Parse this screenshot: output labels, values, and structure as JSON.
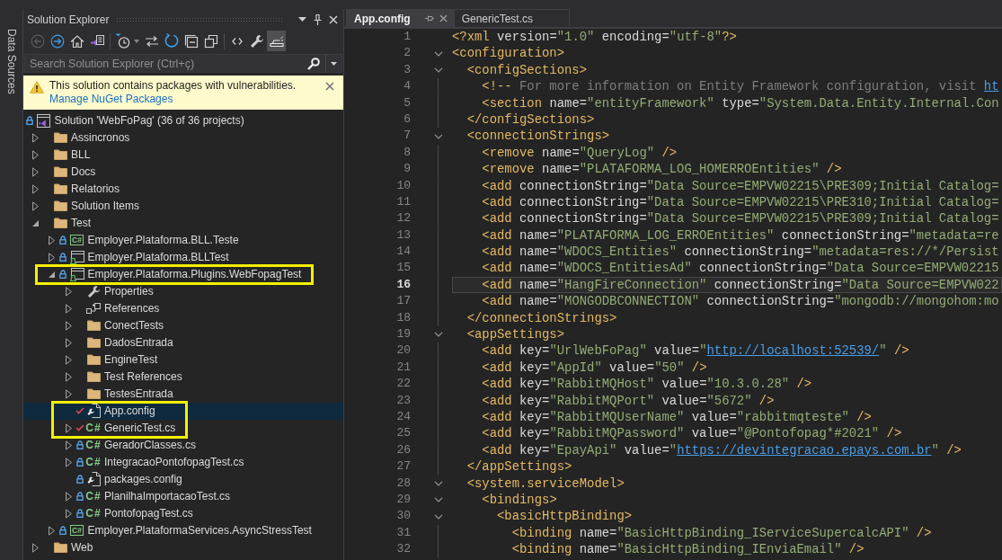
{
  "side_tab": {
    "label": "Data Sources"
  },
  "solution_explorer": {
    "title": "Solution Explorer",
    "toolbar_groups": [
      [
        {
          "kind": "back",
          "disabled": true,
          "on": false
        },
        {
          "kind": "forward",
          "disabled": false,
          "on": false
        },
        {
          "kind": "home",
          "disabled": false,
          "on": false
        },
        {
          "kind": "switch_views",
          "disabled": false,
          "on": false
        }
      ],
      [
        {
          "kind": "pending_changes",
          "disabled": false,
          "on": false
        },
        {
          "kind": "sync",
          "disabled": false,
          "on": false
        },
        {
          "kind": "refresh",
          "disabled": false,
          "on": false
        },
        {
          "kind": "collapse_all",
          "disabled": false,
          "on": false
        },
        {
          "kind": "show_all_files",
          "disabled": false,
          "on": false
        }
      ],
      [
        {
          "kind": "view_code",
          "disabled": false,
          "on": false
        },
        {
          "kind": "properties",
          "disabled": false,
          "on": false
        },
        {
          "kind": "preview",
          "disabled": false,
          "on": true
        }
      ]
    ],
    "search": {
      "placeholder": "Search Solution Explorer (Ctrl+ç)"
    },
    "banner": {
      "message": "This solution contains packages with vulnerabilities.",
      "link": "Manage NuGet Packages"
    },
    "tree": [
      {
        "label": "Solution 'WebFoPag' (36 of 36 projects)",
        "kind": "solution",
        "locked": true,
        "checked_out": false,
        "selected": false,
        "highlighted": false,
        "children": [
          {
            "label": "Assincronos",
            "kind": "folder",
            "locked": false,
            "checked_out": false,
            "expanded": false,
            "selected": false,
            "highlighted": false
          },
          {
            "label": "BLL",
            "kind": "folder",
            "locked": false,
            "checked_out": false,
            "expanded": false,
            "selected": false,
            "highlighted": false
          },
          {
            "label": "Docs",
            "kind": "folder",
            "locked": false,
            "checked_out": false,
            "expanded": false,
            "selected": false,
            "highlighted": false
          },
          {
            "label": "Relatorios",
            "kind": "folder",
            "locked": false,
            "checked_out": false,
            "expanded": false,
            "selected": false,
            "highlighted": false
          },
          {
            "label": "Solution Items",
            "kind": "folder",
            "locked": false,
            "checked_out": false,
            "expanded": false,
            "selected": false,
            "highlighted": false
          },
          {
            "label": "Test",
            "kind": "folder",
            "locked": false,
            "checked_out": false,
            "expanded": true,
            "selected": false,
            "highlighted": false,
            "children": [
              {
                "label": "Employer.Plataforma.BLL.Teste",
                "kind": "csproj",
                "type_label": "C#",
                "locked": true,
                "checked_out": false,
                "expanded": false,
                "selected": false,
                "highlighted": false
              },
              {
                "label": "Employer.Plataforma.BLLTest",
                "kind": "testproj",
                "locked": true,
                "checked_out": false,
                "expanded": false,
                "selected": false,
                "highlighted": false
              },
              {
                "label": "Employer.Plataforma.Plugins.WebFopagTest",
                "kind": "testproj",
                "locked": true,
                "checked_out": false,
                "expanded": true,
                "selected": false,
                "highlighted": true,
                "children": [
                  {
                    "label": "Properties",
                    "kind": "properties",
                    "locked": false,
                    "checked_out": false,
                    "expanded": false,
                    "selected": false,
                    "highlighted": false
                  },
                  {
                    "label": "References",
                    "kind": "references",
                    "locked": false,
                    "checked_out": false,
                    "expanded": false,
                    "selected": false,
                    "highlighted": false
                  },
                  {
                    "label": "ConectTests",
                    "kind": "folder",
                    "locked": false,
                    "checked_out": false,
                    "expanded": false,
                    "selected": false,
                    "highlighted": false
                  },
                  {
                    "label": "DadosEntrada",
                    "kind": "folder",
                    "locked": false,
                    "checked_out": false,
                    "expanded": false,
                    "selected": false,
                    "highlighted": false
                  },
                  {
                    "label": "EngineTest",
                    "kind": "folder",
                    "locked": false,
                    "checked_out": false,
                    "expanded": false,
                    "selected": false,
                    "highlighted": false
                  },
                  {
                    "label": "Test References",
                    "kind": "folder",
                    "locked": false,
                    "checked_out": false,
                    "expanded": false,
                    "selected": false,
                    "highlighted": false
                  },
                  {
                    "label": "TestesEntrada",
                    "kind": "folder",
                    "locked": false,
                    "checked_out": false,
                    "expanded": false,
                    "selected": false,
                    "highlighted": false
                  },
                  {
                    "label": "App.config",
                    "kind": "config",
                    "locked": false,
                    "checked_out": true,
                    "selected": true,
                    "highlighted": true
                  },
                  {
                    "label": "GenericTest.cs",
                    "kind": "cs",
                    "type_label": "C#",
                    "locked": false,
                    "checked_out": true,
                    "expanded": false,
                    "selected": false,
                    "highlighted": true
                  },
                  {
                    "label": "GeradorClasses.cs",
                    "kind": "cs",
                    "type_label": "C#",
                    "locked": true,
                    "checked_out": false,
                    "expanded": false,
                    "selected": false,
                    "highlighted": false
                  },
                  {
                    "label": "IntegracaoPontofopagTest.cs",
                    "kind": "cs",
                    "type_label": "C#",
                    "locked": true,
                    "checked_out": false,
                    "expanded": false,
                    "selected": false,
                    "highlighted": false
                  },
                  {
                    "label": "packages.config",
                    "kind": "config",
                    "locked": true,
                    "checked_out": false,
                    "selected": false,
                    "highlighted": false
                  },
                  {
                    "label": "PlanilhaImportacaoTest.cs",
                    "kind": "cs",
                    "type_label": "C#",
                    "locked": true,
                    "checked_out": false,
                    "expanded": false,
                    "selected": false,
                    "highlighted": false
                  },
                  {
                    "label": "PontofopagTest.cs",
                    "kind": "cs",
                    "type_label": "C#",
                    "locked": true,
                    "checked_out": false,
                    "expanded": false,
                    "selected": false,
                    "highlighted": false
                  }
                ]
              },
              {
                "label": "Employer.PlataformaServices.AsyncStressTest",
                "kind": "csproj",
                "type_label": "C#",
                "locked": true,
                "checked_out": false,
                "expanded": false,
                "selected": false,
                "highlighted": false
              }
            ]
          },
          {
            "label": "Web",
            "kind": "folder",
            "locked": false,
            "checked_out": false,
            "expanded": false,
            "selected": false,
            "highlighted": false
          }
        ]
      }
    ]
  },
  "editor": {
    "tabs": [
      {
        "label": "App.config",
        "selected": true
      },
      {
        "label": "GenericTest.cs",
        "selected": false
      }
    ],
    "lines": [
      {
        "number": "1",
        "text": "<?xml version=\"1.0\" encoding=\"utf-8\"?>",
        "fold": false,
        "current": false
      },
      {
        "number": "2",
        "text": "<configuration>",
        "fold": true,
        "current": false
      },
      {
        "number": "3",
        "text": "  <configSections>",
        "fold": true,
        "current": false
      },
      {
        "number": "4",
        "text": "    <!-- For more information on Entity Framework configuration, visit ",
        "link": "ht",
        "fold": false,
        "current": false
      },
      {
        "number": "5",
        "text": "    <section name=\"entityFramework\" type=\"System.Data.Entity.Internal.Con",
        "fold": false,
        "current": false
      },
      {
        "number": "6",
        "text": "  </configSections>",
        "fold": false,
        "current": false
      },
      {
        "number": "7",
        "text": "  <connectionStrings>",
        "fold": true,
        "current": false
      },
      {
        "number": "8",
        "text": "    <remove name=\"QueryLog\" />",
        "fold": false,
        "current": false
      },
      {
        "number": "9",
        "text": "    <remove name=\"PLATAFORMA_LOG_HOMERROEntities\" />",
        "fold": false,
        "current": false
      },
      {
        "number": "10",
        "text": "    <add connectionString=\"Data Source=EMPVW02215\\PRE309;Initial Catalog=",
        "fold": false,
        "current": false
      },
      {
        "number": "11",
        "text": "    <add connectionString=\"Data Source=EMPVW02215\\PRE310;Initial Catalog=",
        "fold": false,
        "current": false
      },
      {
        "number": "12",
        "text": "    <add connectionString=\"Data Source=EMPVW02215\\PRE309;Initial Catalog=",
        "fold": false,
        "current": false
      },
      {
        "number": "13",
        "text": "    <add name=\"PLATAFORMA_LOG_ERROEntities\" connectionString=\"metadata=re",
        "fold": false,
        "current": false
      },
      {
        "number": "14",
        "text": "    <add name=\"WDOCS_Entities\" connectionString=\"metadata=res://*/Persist",
        "fold": false,
        "current": false
      },
      {
        "number": "15",
        "text": "    <add name=\"WDOCS_EntitiesAd\" connectionString=\"Data Source=EMPVW02215",
        "fold": false,
        "current": false
      },
      {
        "number": "16",
        "text": "    <add name=\"HangFireConnection\" connectionString=\"Data Source=EMPVW022",
        "fold": false,
        "current": true
      },
      {
        "number": "17",
        "text": "    <add name=\"MONGODBCONNECTION\" connectionString=\"mongodb://mongohom:mo",
        "fold": false,
        "current": false
      },
      {
        "number": "18",
        "text": "  </connectionStrings>",
        "fold": false,
        "current": false
      },
      {
        "number": "19",
        "text": "  <appSettings>",
        "fold": true,
        "current": false
      },
      {
        "number": "20",
        "text": "    <add key=\"UrlWebFoPag\" value=\"",
        "link": "http://localhost:52539/",
        "text_after": "\" />",
        "fold": false,
        "current": false
      },
      {
        "number": "21",
        "text": "    <add key=\"AppId\" value=\"50\" />",
        "fold": false,
        "current": false
      },
      {
        "number": "22",
        "text": "    <add key=\"RabbitMQHost\" value=\"10.3.0.28\" />",
        "fold": false,
        "current": false
      },
      {
        "number": "23",
        "text": "    <add key=\"RabbitMQPort\" value=\"5672\" />",
        "fold": false,
        "current": false
      },
      {
        "number": "24",
        "text": "    <add key=\"RabbitMQUserName\" value=\"rabbitmqteste\" />",
        "fold": false,
        "current": false
      },
      {
        "number": "25",
        "text": "    <add key=\"RabbitMQPassword\" value=\"@Pontofopag*#2021\" />",
        "fold": false,
        "current": false
      },
      {
        "number": "26",
        "text": "    <add key=\"EpayApi\" value=\"",
        "link": "https://devintegracao.epays.com.br",
        "text_after": "\" />",
        "fold": false,
        "current": false
      },
      {
        "number": "27",
        "text": "  </appSettings>",
        "fold": false,
        "current": false
      },
      {
        "number": "28",
        "text": "  <system.serviceModel>",
        "fold": true,
        "current": false
      },
      {
        "number": "29",
        "text": "    <bindings>",
        "fold": true,
        "current": false
      },
      {
        "number": "30",
        "text": "      <basicHttpBinding>",
        "fold": true,
        "current": false
      },
      {
        "number": "31",
        "text": "        <binding name=\"BasicHttpBinding_IServiceSupercalcAPI\" />",
        "fold": false,
        "current": false
      },
      {
        "number": "32",
        "text": "        <binding name=\"BasicHttpBinding_IEnviaEmail\" />",
        "fold": false,
        "current": false
      }
    ]
  }
}
